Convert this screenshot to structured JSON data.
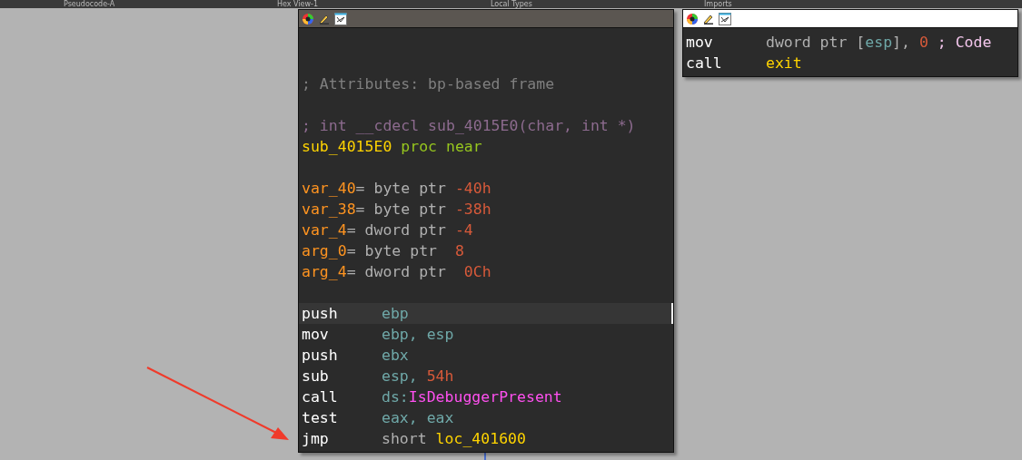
{
  "tabs": [
    {
      "label": "Pseudocode-A",
      "selected": false
    },
    {
      "label": "Hex View-1",
      "selected": false
    },
    {
      "label": "Local Types",
      "selected": false
    },
    {
      "label": "Imports",
      "selected": false
    }
  ],
  "nodes": [
    {
      "kind": "main",
      "lines": [
        {
          "kind": "blank"
        },
        {
          "kind": "blank"
        },
        {
          "kind": "text",
          "selected": false,
          "tokens": [
            {
              "text": "; Attributes: bp-based frame",
              "kind": "comment"
            }
          ]
        },
        {
          "kind": "blank"
        },
        {
          "kind": "text",
          "selected": false,
          "tokens": [
            {
              "text": "; int __cdecl sub_4015E0(char, int *)",
              "kind": "prototype"
            }
          ]
        },
        {
          "kind": "text",
          "selected": false,
          "tokens": [
            {
              "text": "sub_4015E0",
              "kind": "name"
            },
            {
              "text": " proc near",
              "kind": "directive"
            }
          ]
        },
        {
          "kind": "blank"
        },
        {
          "kind": "text",
          "selected": false,
          "tokens": [
            {
              "text": "var_40",
              "kind": "var"
            },
            {
              "text": "= byte ptr ",
              "kind": "plain"
            },
            {
              "text": "-40h",
              "kind": "number"
            }
          ]
        },
        {
          "kind": "text",
          "selected": false,
          "tokens": [
            {
              "text": "var_38",
              "kind": "var"
            },
            {
              "text": "= byte ptr ",
              "kind": "plain"
            },
            {
              "text": "-38h",
              "kind": "number"
            }
          ]
        },
        {
          "kind": "text",
          "selected": false,
          "tokens": [
            {
              "text": "var_4",
              "kind": "var"
            },
            {
              "text": "= dword ptr ",
              "kind": "plain"
            },
            {
              "text": "-4",
              "kind": "number"
            }
          ]
        },
        {
          "kind": "text",
          "selected": false,
          "tokens": [
            {
              "text": "arg_0",
              "kind": "var"
            },
            {
              "text": "= byte ptr  ",
              "kind": "plain"
            },
            {
              "text": "8",
              "kind": "number"
            }
          ]
        },
        {
          "kind": "text",
          "selected": false,
          "tokens": [
            {
              "text": "arg_4",
              "kind": "var"
            },
            {
              "text": "= dword ptr  ",
              "kind": "plain"
            },
            {
              "text": "0Ch",
              "kind": "number"
            }
          ]
        },
        {
          "kind": "blank"
        },
        {
          "kind": "code",
          "selected": true,
          "mnemonic": "push",
          "tokens": [
            {
              "text": "ebp",
              "kind": "register"
            }
          ]
        },
        {
          "kind": "code",
          "selected": false,
          "mnemonic": "mov",
          "tokens": [
            {
              "text": "ebp, esp",
              "kind": "register"
            }
          ]
        },
        {
          "kind": "code",
          "selected": false,
          "mnemonic": "push",
          "tokens": [
            {
              "text": "ebx",
              "kind": "register"
            }
          ]
        },
        {
          "kind": "code",
          "selected": false,
          "mnemonic": "sub",
          "tokens": [
            {
              "text": "esp, ",
              "kind": "register"
            },
            {
              "text": "54h",
              "kind": "number"
            }
          ]
        },
        {
          "kind": "code",
          "selected": false,
          "mnemonic": "call",
          "tokens": [
            {
              "text": "ds:",
              "kind": "register"
            },
            {
              "text": "IsDebuggerPresent",
              "kind": "import"
            }
          ]
        },
        {
          "kind": "code",
          "selected": false,
          "mnemonic": "test",
          "tokens": [
            {
              "text": "eax, eax",
              "kind": "register"
            }
          ]
        },
        {
          "kind": "code",
          "selected": false,
          "mnemonic": "jmp",
          "tokens": [
            {
              "text": "short ",
              "kind": "plain"
            },
            {
              "text": "loc_401600",
              "kind": "name"
            }
          ]
        }
      ]
    },
    {
      "kind": "side",
      "lines": [
        {
          "kind": "code",
          "selected": false,
          "mnemonic": "mov",
          "tokens": [
            {
              "text": "dword ptr [",
              "kind": "plain"
            },
            {
              "text": "esp",
              "kind": "register"
            },
            {
              "text": "], ",
              "kind": "plain"
            },
            {
              "text": "0",
              "kind": "number"
            },
            {
              "text": " ; Code",
              "kind": "xref"
            }
          ]
        },
        {
          "kind": "code",
          "selected": false,
          "mnemonic": "call",
          "tokens": [
            {
              "text": "exit",
              "kind": "name"
            }
          ]
        }
      ]
    }
  ]
}
